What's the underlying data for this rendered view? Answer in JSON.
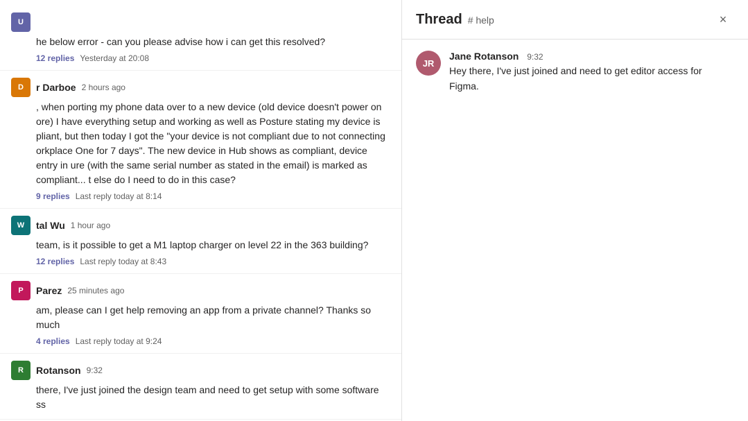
{
  "left_panel": {
    "messages": [
      {
        "id": "msg1",
        "author": "",
        "avatar_color": "purple",
        "avatar_initials": "U",
        "timestamp": "",
        "body": "he below error - can you please advise how i can get this resolved?",
        "replies_count": "12 replies",
        "last_reply": "Yesterday at 20:08"
      },
      {
        "id": "msg2",
        "author": "r Darboe",
        "avatar_color": "orange",
        "avatar_initials": "D",
        "timestamp": "2 hours ago",
        "body": ", when porting my phone data over to a new device (old device doesn't power on ore) I have everything setup and working as well as Posture stating my device is pliant, but then today I got the \"your device is not compliant due to not connecting orkplace One for 7 days\". The new device in Hub shows as compliant, device entry in ure (with the same serial number as stated in the email) is marked as compliant... t else do I need to do in this case?",
        "replies_count": "9 replies",
        "last_reply": "Last reply today at 8:14"
      },
      {
        "id": "msg3",
        "author": "tal Wu",
        "avatar_color": "teal",
        "avatar_initials": "W",
        "timestamp": "1 hour ago",
        "body": "team, is it possible to get a M1 laptop charger on level 22 in the 363 building?",
        "replies_count": "12 replies",
        "last_reply": "Last reply today at 8:43"
      },
      {
        "id": "msg4",
        "author": "Parez",
        "avatar_color": "pink",
        "avatar_initials": "P",
        "timestamp": "25 minutes ago",
        "body": "am, please can I get help removing an app from a private channel? Thanks so much",
        "replies_count": "4 replies",
        "last_reply": "Last reply today at 9:24"
      },
      {
        "id": "msg5",
        "author": "Rotanson",
        "avatar_color": "green",
        "avatar_initials": "R",
        "timestamp": "9:32",
        "body": "there, I've just joined the design team and need to get setup with some software ss",
        "replies_count": "",
        "last_reply": ""
      }
    ]
  },
  "right_panel": {
    "title": "Thread",
    "channel": "# help",
    "close_label": "×",
    "messages": [
      {
        "id": "thread1",
        "author": "Jane Rotanson",
        "avatar_color": "pink",
        "avatar_initials": "JR",
        "timestamp": "9:32",
        "text": "Hey there, I've just joined and need to get editor access for Figma."
      }
    ]
  }
}
